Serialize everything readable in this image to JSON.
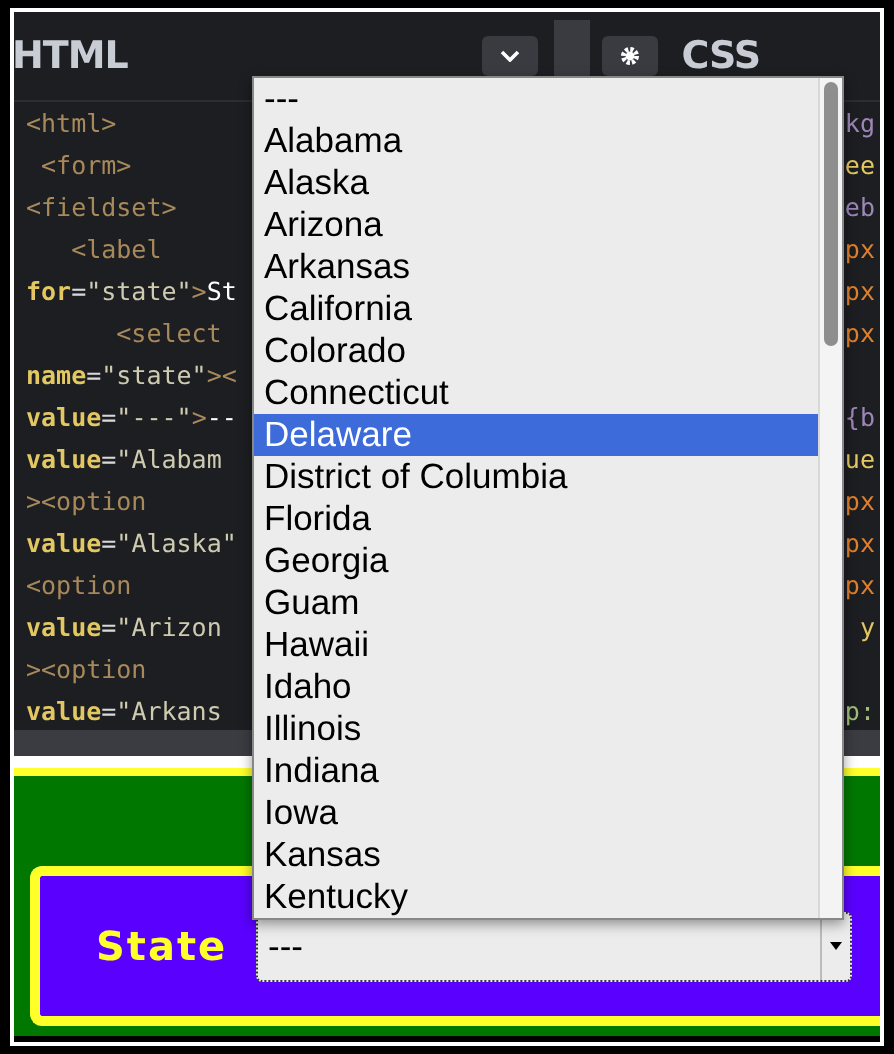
{
  "html_panel": {
    "title": "HTML"
  },
  "css_panel": {
    "title": "CSS"
  },
  "html_code": [
    [
      {
        "kind": "tag",
        "text": "<html>"
      }
    ],
    [
      {
        "kind": "tag",
        "text": " <form>"
      }
    ],
    [
      {
        "kind": "tag",
        "text": "<fieldset>"
      }
    ],
    [
      {
        "kind": "tag",
        "text": "   <label"
      }
    ],
    [
      {
        "kind": "attr",
        "text": "for"
      },
      {
        "kind": "punct",
        "text": "="
      },
      {
        "kind": "string",
        "text": "\"state\""
      },
      {
        "kind": "tag",
        "text": ">"
      },
      {
        "kind": "text",
        "text": "St"
      }
    ],
    [
      {
        "kind": "tag",
        "text": "      <select"
      }
    ],
    [
      {
        "kind": "attr",
        "text": "name"
      },
      {
        "kind": "punct",
        "text": "="
      },
      {
        "kind": "string",
        "text": "\"state\""
      },
      {
        "kind": "tag",
        "text": "><"
      }
    ],
    [
      {
        "kind": "attr",
        "text": "value"
      },
      {
        "kind": "punct",
        "text": "="
      },
      {
        "kind": "string",
        "text": "\"---\""
      },
      {
        "kind": "tag",
        "text": ">"
      },
      {
        "kind": "text",
        "text": "--"
      }
    ],
    [
      {
        "kind": "attr",
        "text": "value"
      },
      {
        "kind": "punct",
        "text": "="
      },
      {
        "kind": "string",
        "text": "\"Alabam"
      }
    ],
    [
      {
        "kind": "tag",
        "text": "><option"
      }
    ],
    [
      {
        "kind": "attr",
        "text": "value"
      },
      {
        "kind": "punct",
        "text": "="
      },
      {
        "kind": "string",
        "text": "\"Alaska\""
      }
    ],
    [
      {
        "kind": "tag",
        "text": "<option"
      }
    ],
    [
      {
        "kind": "attr",
        "text": "value"
      },
      {
        "kind": "punct",
        "text": "="
      },
      {
        "kind": "string",
        "text": "\"Arizon"
      }
    ],
    [
      {
        "kind": "tag",
        "text": "><option"
      }
    ],
    [
      {
        "kind": "attr",
        "text": "value"
      },
      {
        "kind": "punct",
        "text": "="
      },
      {
        "kind": "string",
        "text": "\"Arkans"
      }
    ]
  ],
  "css_code": [
    {
      "kind": "value",
      "text": "kg"
    },
    {
      "kind": "prop",
      "text": "ee"
    },
    {
      "kind": "value",
      "text": "eb"
    },
    {
      "kind": "unit",
      "text": "px"
    },
    {
      "kind": "unit",
      "text": "px"
    },
    {
      "kind": "unit",
      "text": "px"
    },
    {
      "kind": "blank"
    },
    {
      "kind": "value",
      "text": "{b"
    },
    {
      "kind": "prop",
      "text": "ue"
    },
    {
      "kind": "unit",
      "text": "px"
    },
    {
      "kind": "unit",
      "text": "px"
    },
    {
      "kind": "unit",
      "text": "px"
    },
    {
      "kind": "prop",
      "text": " y"
    },
    {
      "kind": "blank"
    },
    {
      "kind": "green",
      "text": "p:"
    }
  ],
  "dropdown": {
    "options": [
      {
        "label": "---",
        "selected": false
      },
      {
        "label": "Alabama",
        "selected": false
      },
      {
        "label": "Alaska",
        "selected": false
      },
      {
        "label": "Arizona",
        "selected": false
      },
      {
        "label": "Arkansas",
        "selected": false
      },
      {
        "label": "California",
        "selected": false
      },
      {
        "label": "Colorado",
        "selected": false
      },
      {
        "label": "Connecticut",
        "selected": false
      },
      {
        "label": "Delaware",
        "selected": true
      },
      {
        "label": "District of Columbia",
        "selected": false
      },
      {
        "label": "Florida",
        "selected": false
      },
      {
        "label": "Georgia",
        "selected": false
      },
      {
        "label": "Guam",
        "selected": false
      },
      {
        "label": "Hawaii",
        "selected": false
      },
      {
        "label": "Idaho",
        "selected": false
      },
      {
        "label": "Illinois",
        "selected": false
      },
      {
        "label": "Indiana",
        "selected": false
      },
      {
        "label": "Iowa",
        "selected": false
      },
      {
        "label": "Kansas",
        "selected": false
      },
      {
        "label": "Kentucky",
        "selected": false
      }
    ]
  },
  "form": {
    "label": "State",
    "select_value": "---"
  }
}
